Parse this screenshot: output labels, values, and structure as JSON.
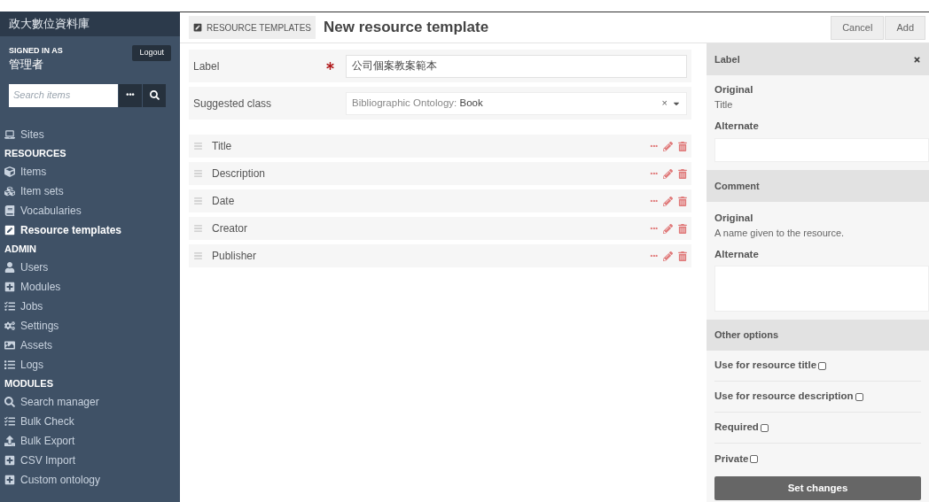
{
  "sidebar": {
    "site_title": "政大數位資料庫",
    "signed_in_label": "SIGNED IN AS",
    "user_name": "管理者",
    "logout": "Logout",
    "search": {
      "placeholder": "Search items",
      "options_button": "•••"
    },
    "top_items": [
      {
        "label": "Sites",
        "selected": false
      }
    ],
    "sections": [
      {
        "heading": "RESOURCES",
        "items": [
          {
            "label": "Items",
            "selected": false
          },
          {
            "label": "Item sets",
            "selected": false
          },
          {
            "label": "Vocabularies",
            "selected": false
          },
          {
            "label": "Resource templates",
            "selected": true
          }
        ]
      },
      {
        "heading": "ADMIN",
        "items": [
          {
            "label": "Users",
            "selected": false
          },
          {
            "label": "Modules",
            "selected": false
          },
          {
            "label": "Jobs",
            "selected": false
          },
          {
            "label": "Settings",
            "selected": false
          },
          {
            "label": "Assets",
            "selected": false
          },
          {
            "label": "Logs",
            "selected": false
          }
        ]
      },
      {
        "heading": "MODULES",
        "items": [
          {
            "label": "Search manager",
            "selected": false
          },
          {
            "label": "Bulk Check",
            "selected": false
          },
          {
            "label": "Bulk Export",
            "selected": false
          },
          {
            "label": "CSV Import",
            "selected": false
          },
          {
            "label": "Custom ontology",
            "selected": false
          }
        ]
      }
    ]
  },
  "header": {
    "breadcrumb": "RESOURCE TEMPLATES",
    "title": "New resource template",
    "buttons": [
      "Cancel",
      "Add"
    ]
  },
  "form": {
    "label_field": {
      "label": "Label",
      "required": true,
      "value": "公司個案教案範本"
    },
    "class_field": {
      "label": "Suggested class",
      "vocabulary": "Bibliographic Ontology:",
      "value": "Book",
      "clear": "×"
    },
    "properties": [
      {
        "label": "Title"
      },
      {
        "label": "Description"
      },
      {
        "label": "Date"
      },
      {
        "label": "Creator"
      },
      {
        "label": "Publisher"
      }
    ],
    "property_options": "•••"
  },
  "panel": {
    "label_section": {
      "heading": "Label",
      "original_label": "Original",
      "original": "Title",
      "alternate_label": "Alternate"
    },
    "comment_section": {
      "heading": "Comment",
      "original_label": "Original",
      "original": "A name given to the resource.",
      "alternate_label": "Alternate"
    },
    "options_section": {
      "heading": "Other options",
      "options": [
        {
          "label": "Use for resource title",
          "checked": false
        },
        {
          "label": "Use for resource description",
          "checked": false
        },
        {
          "label": "Required",
          "checked": false
        },
        {
          "label": "Private",
          "checked": false
        }
      ]
    },
    "submit": "Set changes"
  }
}
